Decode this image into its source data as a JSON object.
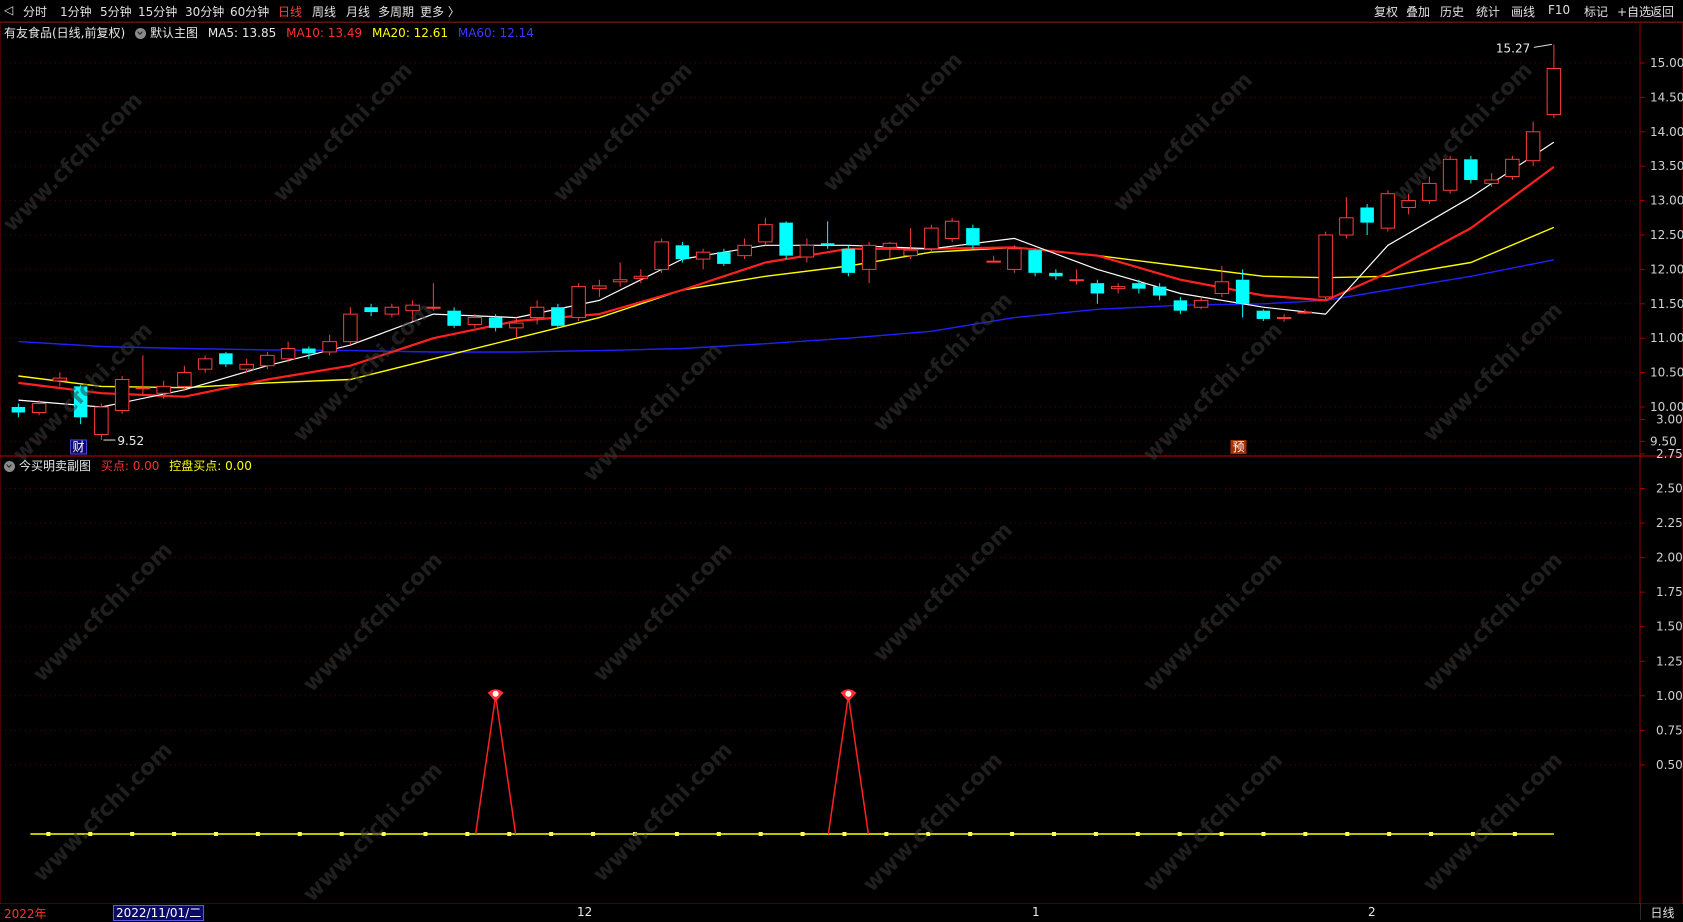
{
  "toolbar": {
    "periods": [
      "分时",
      "1分钟",
      "5分钟",
      "15分钟",
      "30分钟",
      "60分钟",
      "日线",
      "周线",
      "月线",
      "多周期",
      "更多 〉"
    ],
    "active": "日线",
    "right": [
      "复权",
      "叠加",
      "历史",
      "统计",
      "画线",
      "F10",
      "标记",
      "+自选",
      "返回"
    ]
  },
  "main": {
    "stock": "有友食品(日线,前复权)",
    "indicator": "默认主图",
    "ma5": "MA5: 13.85",
    "ma10": "MA10: 13.49",
    "ma20": "MA20: 12.61",
    "ma60": "MA60: 12.14",
    "high_label": "15.27",
    "low_label": "9.52",
    "marker_cai": "财",
    "marker_yu": "预",
    "ticks": [
      "15.00",
      "14.50",
      "14.00",
      "13.50",
      "13.00",
      "12.50",
      "12.00",
      "11.50",
      "11.00",
      "10.50",
      "10.00",
      "9.50"
    ]
  },
  "sub": {
    "title": "今买明卖副图",
    "buy": "买点: 0.00",
    "ctrl": "控盘买点: 0.00",
    "ticks": [
      "3.00",
      "2.75",
      "2.50",
      "2.25",
      "2.00",
      "1.75",
      "1.50",
      "1.25",
      "1.00",
      "0.75",
      "0.50"
    ]
  },
  "bottom": {
    "year": "2022年",
    "date": "2022/11/01/二",
    "m12": "12",
    "m1": "1",
    "m2": "2",
    "view": "日线"
  },
  "watermark": "www.cfchi.com",
  "colors": {
    "up": "#ff3b3b",
    "down": "#00ffff",
    "ma5": "#ffffff",
    "ma10": "#ff2020",
    "ma20": "#ffff00",
    "ma60": "#2020ff"
  },
  "chart_data": {
    "type": "candlestick",
    "x_start": "2022/11/01",
    "price_range": [
      9.25,
      15.5
    ],
    "candles": [
      [
        10.0,
        9.92,
        10.05,
        9.85
      ],
      [
        9.92,
        10.05,
        10.1,
        9.88
      ],
      [
        10.38,
        10.42,
        10.5,
        10.3
      ],
      [
        10.3,
        9.85,
        10.32,
        9.75
      ],
      [
        9.6,
        10.0,
        10.05,
        9.52
      ],
      [
        9.95,
        10.4,
        10.45,
        9.9
      ],
      [
        10.28,
        10.28,
        10.75,
        10.18
      ],
      [
        10.2,
        10.3,
        10.38,
        10.12
      ],
      [
        10.3,
        10.5,
        10.6,
        10.25
      ],
      [
        10.55,
        10.7,
        10.75,
        10.5
      ],
      [
        10.78,
        10.62,
        10.8,
        10.58
      ],
      [
        10.55,
        10.62,
        10.7,
        10.5
      ],
      [
        10.6,
        10.75,
        10.8,
        10.55
      ],
      [
        10.7,
        10.85,
        10.95,
        10.65
      ],
      [
        10.85,
        10.78,
        10.88,
        10.7
      ],
      [
        10.8,
        10.95,
        11.05,
        10.75
      ],
      [
        10.95,
        11.35,
        11.45,
        10.9
      ],
      [
        11.45,
        11.38,
        11.5,
        11.32
      ],
      [
        11.35,
        11.45,
        11.5,
        11.3
      ],
      [
        11.4,
        11.48,
        11.55,
        11.25
      ],
      [
        11.45,
        11.45,
        11.8,
        11.4
      ],
      [
        11.4,
        11.18,
        11.45,
        11.15
      ],
      [
        11.2,
        11.3,
        11.35,
        11.15
      ],
      [
        11.3,
        11.15,
        11.35,
        11.1
      ],
      [
        11.15,
        11.22,
        11.3,
        11.0
      ],
      [
        11.3,
        11.45,
        11.55,
        11.2
      ],
      [
        11.45,
        11.18,
        11.5,
        11.15
      ],
      [
        11.3,
        11.75,
        11.8,
        11.25
      ],
      [
        11.72,
        11.76,
        11.85,
        11.6
      ],
      [
        11.82,
        11.85,
        12.1,
        11.75
      ],
      [
        11.87,
        11.9,
        12.0,
        11.8
      ],
      [
        12.0,
        12.4,
        12.45,
        11.95
      ],
      [
        12.35,
        12.15,
        12.4,
        12.1
      ],
      [
        12.15,
        12.25,
        12.3,
        12.0
      ],
      [
        12.25,
        12.08,
        12.3,
        12.05
      ],
      [
        12.2,
        12.35,
        12.45,
        12.15
      ],
      [
        12.4,
        12.65,
        12.75,
        12.35
      ],
      [
        12.68,
        12.2,
        12.7,
        12.15
      ],
      [
        12.18,
        12.35,
        12.45,
        12.1
      ],
      [
        12.38,
        12.35,
        12.7,
        12.3
      ],
      [
        12.3,
        11.95,
        12.35,
        11.9
      ],
      [
        12.0,
        12.35,
        12.4,
        11.8
      ],
      [
        12.32,
        12.38,
        12.4,
        12.15
      ],
      [
        12.2,
        12.28,
        12.6,
        12.15
      ],
      [
        12.3,
        12.6,
        12.65,
        12.25
      ],
      [
        12.45,
        12.7,
        12.75,
        12.4
      ],
      [
        12.6,
        12.35,
        12.65,
        12.3
      ],
      [
        12.12,
        12.12,
        12.2,
        12.1
      ],
      [
        12.0,
        12.3,
        12.35,
        11.95
      ],
      [
        12.28,
        11.95,
        12.3,
        11.9
      ],
      [
        11.95,
        11.9,
        12.0,
        11.85
      ],
      [
        11.85,
        11.85,
        12.0,
        11.78
      ],
      [
        11.8,
        11.65,
        11.85,
        11.5
      ],
      [
        11.72,
        11.75,
        11.8,
        11.65
      ],
      [
        11.8,
        11.72,
        11.85,
        11.65
      ],
      [
        11.75,
        11.62,
        11.8,
        11.55
      ],
      [
        11.55,
        11.4,
        11.6,
        11.35
      ],
      [
        11.45,
        11.55,
        11.6,
        11.42
      ],
      [
        11.65,
        11.82,
        12.05,
        11.6
      ],
      [
        11.85,
        11.5,
        12.0,
        11.3
      ],
      [
        11.4,
        11.28,
        11.42,
        11.25
      ],
      [
        11.3,
        11.3,
        11.35,
        11.24
      ],
      [
        11.38,
        11.38,
        11.42,
        11.35
      ],
      [
        11.6,
        12.5,
        12.55,
        11.55
      ],
      [
        12.5,
        12.75,
        13.05,
        12.45
      ],
      [
        12.9,
        12.68,
        12.95,
        12.5
      ],
      [
        12.6,
        13.1,
        13.15,
        12.55
      ],
      [
        12.9,
        13.0,
        13.1,
        12.8
      ],
      [
        13.0,
        13.25,
        13.35,
        12.95
      ],
      [
        13.15,
        13.6,
        13.65,
        13.1
      ],
      [
        13.6,
        13.3,
        13.65,
        13.25
      ],
      [
        13.25,
        13.3,
        13.4,
        13.2
      ],
      [
        13.35,
        13.6,
        13.65,
        13.3
      ],
      [
        13.58,
        14.0,
        14.15,
        13.5
      ],
      [
        14.25,
        14.92,
        15.27,
        14.2
      ]
    ],
    "ma5": [
      [
        0,
        10.1
      ],
      [
        4,
        10.0
      ],
      [
        8,
        10.25
      ],
      [
        12,
        10.6
      ],
      [
        16,
        10.9
      ],
      [
        20,
        11.35
      ],
      [
        24,
        11.3
      ],
      [
        28,
        11.55
      ],
      [
        32,
        12.15
      ],
      [
        36,
        12.35
      ],
      [
        40,
        12.35
      ],
      [
        44,
        12.3
      ],
      [
        48,
        12.45
      ],
      [
        52,
        12.0
      ],
      [
        56,
        11.65
      ],
      [
        60,
        11.45
      ],
      [
        63,
        11.35
      ],
      [
        66,
        12.35
      ],
      [
        70,
        13.05
      ],
      [
        74,
        13.85
      ]
    ],
    "ma10": [
      [
        0,
        10.35
      ],
      [
        4,
        10.2
      ],
      [
        8,
        10.15
      ],
      [
        12,
        10.4
      ],
      [
        16,
        10.6
      ],
      [
        20,
        11.0
      ],
      [
        24,
        11.25
      ],
      [
        28,
        11.35
      ],
      [
        32,
        11.7
      ],
      [
        36,
        12.1
      ],
      [
        40,
        12.3
      ],
      [
        44,
        12.3
      ],
      [
        48,
        12.32
      ],
      [
        52,
        12.2
      ],
      [
        56,
        11.85
      ],
      [
        60,
        11.62
      ],
      [
        63,
        11.55
      ],
      [
        66,
        11.95
      ],
      [
        70,
        12.6
      ],
      [
        74,
        13.49
      ]
    ],
    "ma20": [
      [
        0,
        10.45
      ],
      [
        4,
        10.3
      ],
      [
        8,
        10.28
      ],
      [
        12,
        10.35
      ],
      [
        16,
        10.4
      ],
      [
        20,
        10.7
      ],
      [
        24,
        11.0
      ],
      [
        28,
        11.3
      ],
      [
        32,
        11.7
      ],
      [
        36,
        11.9
      ],
      [
        40,
        12.05
      ],
      [
        44,
        12.25
      ],
      [
        48,
        12.32
      ],
      [
        52,
        12.2
      ],
      [
        56,
        12.05
      ],
      [
        60,
        11.9
      ],
      [
        63,
        11.88
      ],
      [
        66,
        11.9
      ],
      [
        70,
        12.1
      ],
      [
        74,
        12.61
      ]
    ],
    "ma60": [
      [
        0,
        10.95
      ],
      [
        4,
        10.88
      ],
      [
        8,
        10.85
      ],
      [
        12,
        10.83
      ],
      [
        16,
        10.82
      ],
      [
        20,
        10.8
      ],
      [
        24,
        10.8
      ],
      [
        28,
        10.82
      ],
      [
        32,
        10.85
      ],
      [
        36,
        10.92
      ],
      [
        40,
        11.0
      ],
      [
        44,
        11.1
      ],
      [
        48,
        11.3
      ],
      [
        52,
        11.42
      ],
      [
        56,
        11.48
      ],
      [
        60,
        11.5
      ],
      [
        63,
        11.55
      ],
      [
        66,
        11.7
      ],
      [
        70,
        11.9
      ],
      [
        74,
        12.14
      ]
    ],
    "indicator": {
      "spikes": [
        [
          23,
          1.0
        ],
        [
          40,
          1.0
        ]
      ],
      "range": [
        0,
        3.25
      ]
    }
  }
}
